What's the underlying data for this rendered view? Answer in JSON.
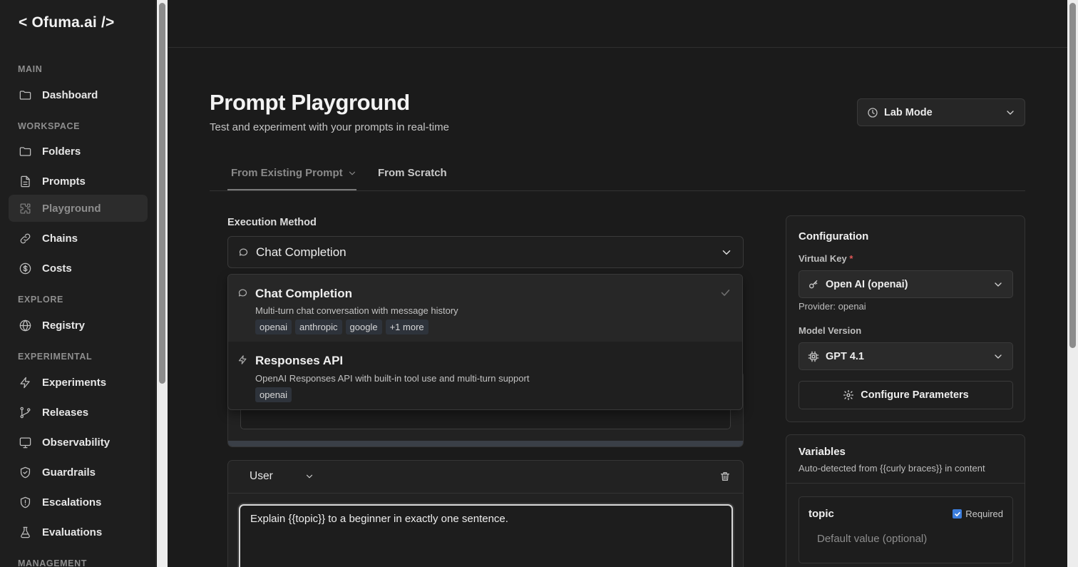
{
  "app": {
    "logo": "< Ofuma.ai />"
  },
  "sidebar": {
    "sections": {
      "main": "MAIN",
      "workspace": "WORKSPACE",
      "explore": "EXPLORE",
      "experimental": "EXPERIMENTAL",
      "management": "MANAGEMENT"
    },
    "items": {
      "dashboard": "Dashboard",
      "folders": "Folders",
      "prompts": "Prompts",
      "playground": "Playground",
      "chains": "Chains",
      "costs": "Costs",
      "registry": "Registry",
      "experiments": "Experiments",
      "releases": "Releases",
      "observability": "Observability",
      "guardrails": "Guardrails",
      "escalations": "Escalations",
      "evaluations": "Evaluations"
    },
    "active": "playground"
  },
  "header": {
    "title": "Prompt Playground",
    "subtitle": "Test and experiment with your prompts in real-time",
    "mode_select": "Lab Mode"
  },
  "tabs": {
    "from_existing": "From Existing Prompt",
    "from_scratch": "From Scratch"
  },
  "execution": {
    "label": "Execution Method",
    "selected": "Chat Completion",
    "options": [
      {
        "title": "Chat Completion",
        "description": "Multi-turn chat conversation with message history",
        "tags": [
          "openai",
          "anthropic",
          "google",
          "+1 more"
        ],
        "selected": true
      },
      {
        "title": "Responses API",
        "description": "OpenAI Responses API with built-in tool use and multi-turn support",
        "tags": [
          "openai"
        ],
        "selected": false
      }
    ]
  },
  "message": {
    "role": "User",
    "content": "Explain {{topic}} to a beginner in exactly one sentence."
  },
  "configuration": {
    "title": "Configuration",
    "virtual_key_label": "Virtual Key",
    "required_mark": "*",
    "virtual_key_value": "Open AI (openai)",
    "provider_text": "Provider: openai",
    "model_version_label": "Model Version",
    "model_version_value": "GPT 4.1",
    "configure_button": "Configure Parameters"
  },
  "variables": {
    "title": "Variables",
    "subtitle": "Auto-detected from {{curly braces}} in content",
    "items": [
      {
        "name": "topic",
        "required_label": "Required",
        "required": true,
        "default_placeholder": "Default value (optional)"
      }
    ]
  },
  "colors": {
    "accent_checkbox": "#3b7ddd",
    "required_star": "#e05757",
    "tag_bg": "#2e333b"
  }
}
